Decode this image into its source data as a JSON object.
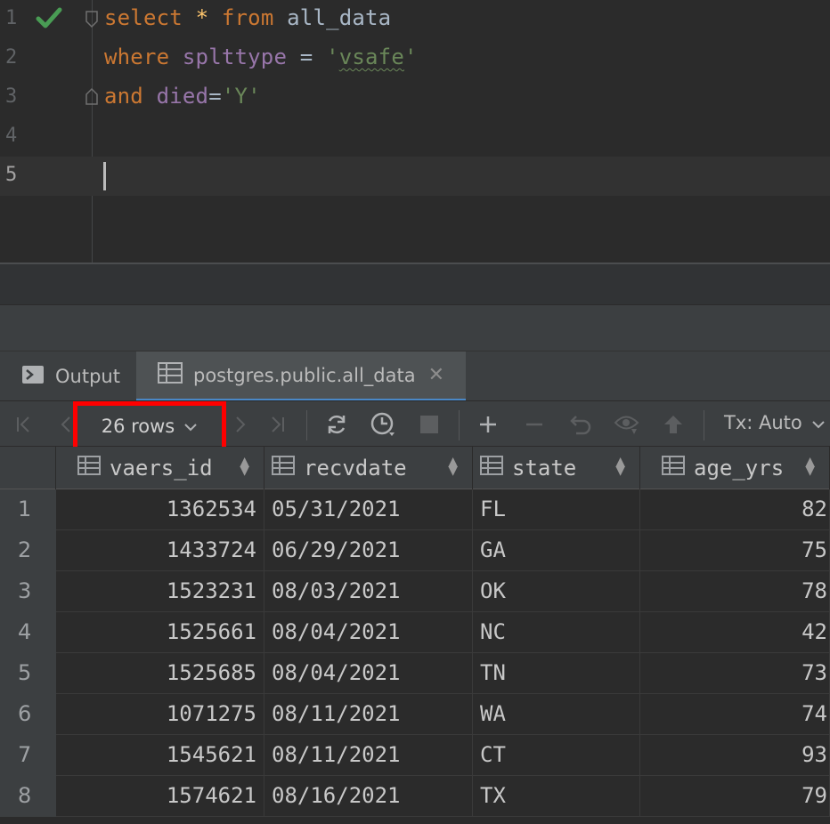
{
  "editor": {
    "lines": [
      {
        "number": "1"
      },
      {
        "number": "2"
      },
      {
        "number": "3"
      },
      {
        "number": "4"
      },
      {
        "number": "5"
      }
    ],
    "code": {
      "l1_kw1": "select",
      "l1_star": "*",
      "l1_kw2": "from",
      "l1_table": "all_data",
      "l2_kw": "where",
      "l2_col": "splttype",
      "l2_eq": "=",
      "l2_q1": "'",
      "l2_val": "vsafe",
      "l2_q2": "'",
      "l3_kw": "and",
      "l3_col": "died",
      "l3_eq": "=",
      "l3_val": "'Y'"
    }
  },
  "tabs": {
    "output_label": "Output",
    "data_label": "postgres.public.all_data",
    "close_symbol": "✕"
  },
  "toolbar": {
    "rows_label": "26 rows",
    "tx_label": "Tx: Auto"
  },
  "grid": {
    "columns": [
      "vaers_id",
      "recvdate",
      "state",
      "age_yrs"
    ],
    "rows": [
      {
        "n": "1",
        "vaers_id": "1362534",
        "recvdate": "05/31/2021",
        "state": "FL",
        "age_yrs": "82"
      },
      {
        "n": "2",
        "vaers_id": "1433724",
        "recvdate": "06/29/2021",
        "state": "GA",
        "age_yrs": "75"
      },
      {
        "n": "3",
        "vaers_id": "1523231",
        "recvdate": "08/03/2021",
        "state": "OK",
        "age_yrs": "78"
      },
      {
        "n": "4",
        "vaers_id": "1525661",
        "recvdate": "08/04/2021",
        "state": "NC",
        "age_yrs": "42"
      },
      {
        "n": "5",
        "vaers_id": "1525685",
        "recvdate": "08/04/2021",
        "state": "TN",
        "age_yrs": "73"
      },
      {
        "n": "6",
        "vaers_id": "1071275",
        "recvdate": "08/11/2021",
        "state": "WA",
        "age_yrs": "74"
      },
      {
        "n": "7",
        "vaers_id": "1545621",
        "recvdate": "08/11/2021",
        "state": "CT",
        "age_yrs": "93"
      },
      {
        "n": "8",
        "vaers_id": "1574621",
        "recvdate": "08/16/2021",
        "state": "TX",
        "age_yrs": "79"
      }
    ]
  },
  "colors": {
    "keyword": "#cc7832",
    "string": "#6a8759",
    "column": "#9876aa",
    "highlight_box": "#ff0000"
  }
}
